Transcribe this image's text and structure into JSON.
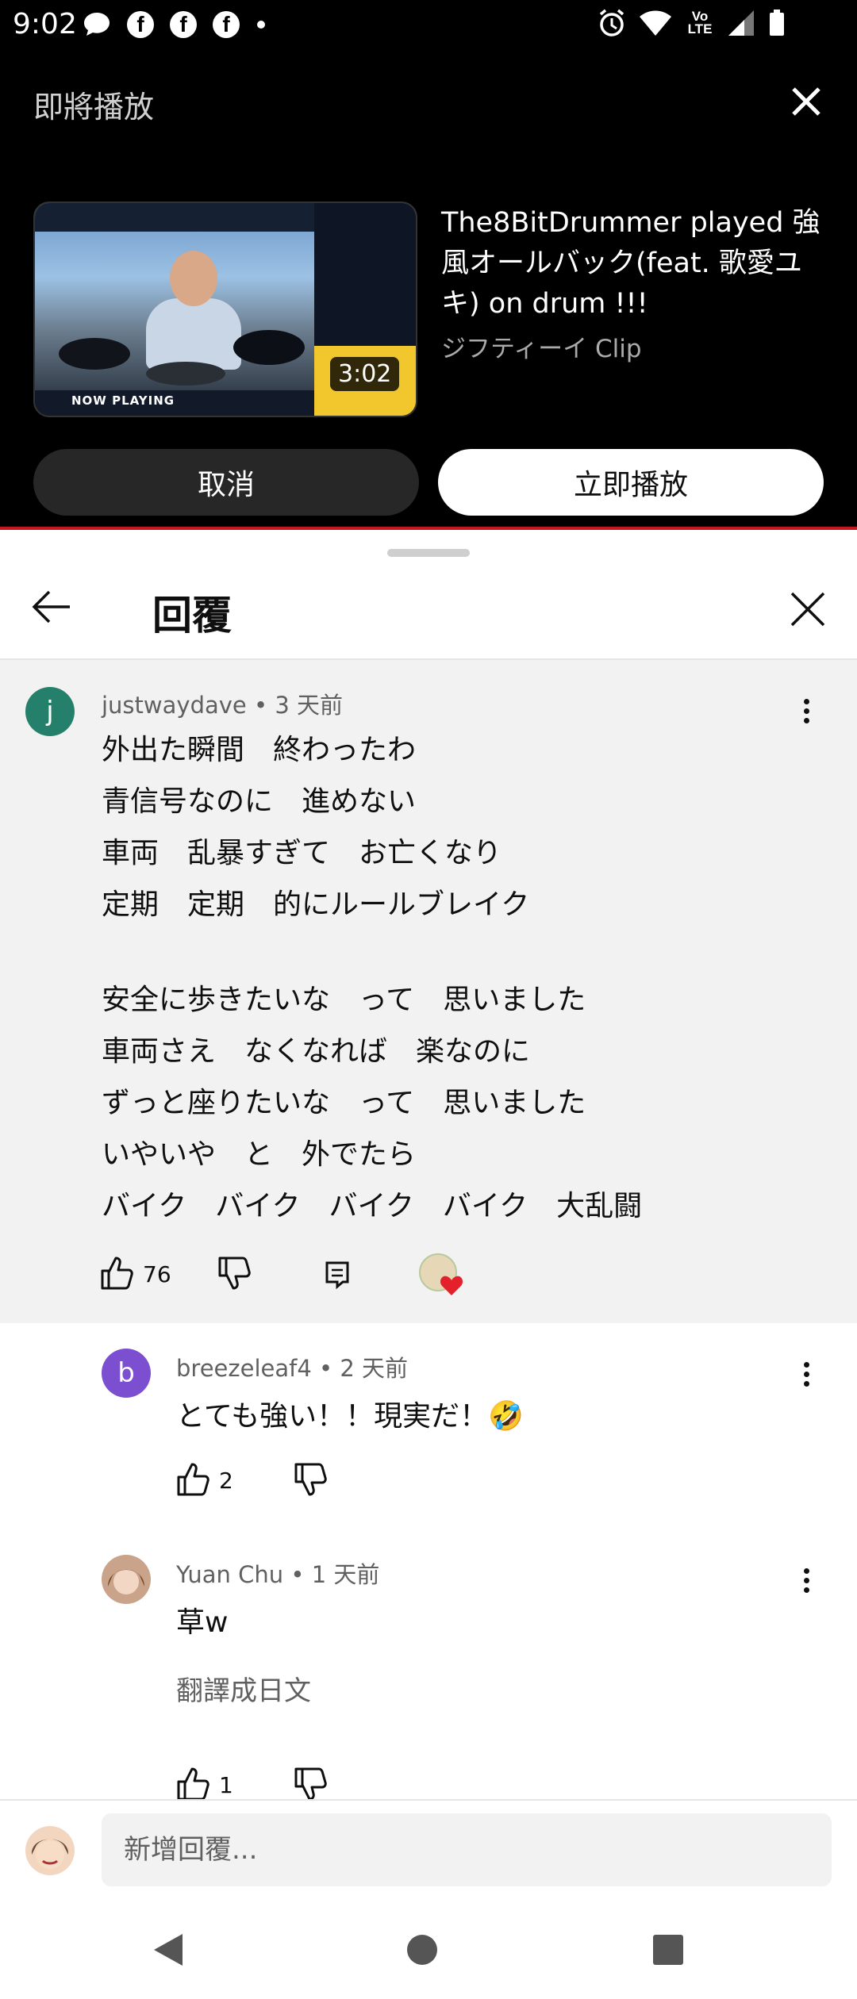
{
  "status_bar": {
    "time": "9:02",
    "carrier": "Vo LTE"
  },
  "up_next": {
    "label": "即將播放",
    "duration": "3:02",
    "title": "The8BitDrummer played 強風オールバック(feat. 歌愛ユキ) on drum !!!",
    "channel": "ジフティーイ Clip",
    "thumbnail_banner": "NOW PLAYING",
    "cancel_label": "取消",
    "play_now_label": "立即播放"
  },
  "sheet": {
    "title": "回覆",
    "input_placeholder": "新增回覆..."
  },
  "parent_comment": {
    "author": "justwaydave",
    "time": "3 天前",
    "avatar_letter": "j",
    "avatar_color": "#24806b",
    "lines": [
      "外出た瞬間　終わったわ",
      "青信号なのに　進めない",
      "車両　乱暴すぎて　お亡くなり",
      "定期　定期　的にルールブレイク",
      "",
      "安全に歩きたいな　って　思いました",
      "車両さえ　なくなれば　楽なのに",
      "ずっと座りたいな　って　思いました",
      "いやいや　と　外でたら",
      "バイク　バイク　バイク　バイク　大乱闘"
    ],
    "likes": "76",
    "creator_heart": true
  },
  "replies": [
    {
      "author": "breezeleaf4",
      "time": "2 天前",
      "avatar_letter": "b",
      "avatar_color": "#7b4fcf",
      "text": "とても強い！！現実だ！🤣",
      "likes": "2"
    },
    {
      "author": "Yuan Chu",
      "time": "1 天前",
      "text": "草w",
      "translate_label": "翻譯成日文",
      "likes": "1"
    }
  ],
  "colors": {
    "accent_red": "#c4161c",
    "heart": "#e4202a"
  }
}
